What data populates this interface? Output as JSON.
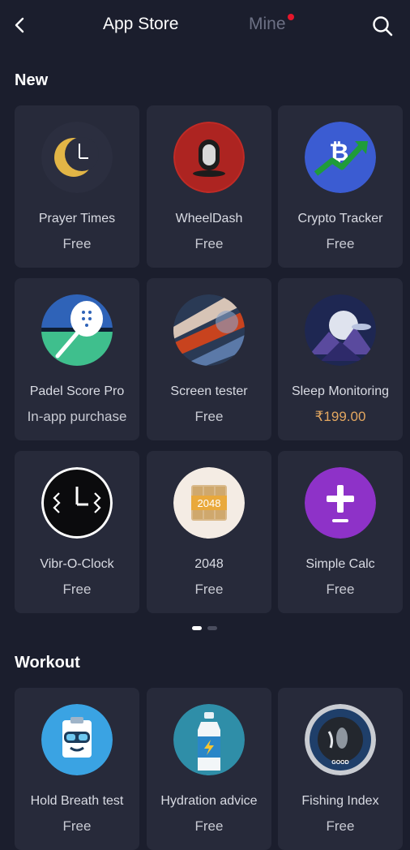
{
  "header": {
    "tab_app_store": "App Store",
    "tab_mine": "Mine",
    "mine_badge_color": "#e5162b"
  },
  "sections": {
    "new": {
      "title": "New",
      "apps": [
        {
          "name": "Prayer Times",
          "price": "Free",
          "icon": "crescent-clock-icon"
        },
        {
          "name": "WheelDash",
          "price": "Free",
          "icon": "unicycle-icon"
        },
        {
          "name": "Crypto Tracker",
          "price": "Free",
          "icon": "bitcoin-chart-icon"
        },
        {
          "name": "Padel Score Pro",
          "price": "In-app purchase",
          "icon": "padel-racket-icon"
        },
        {
          "name": "Screen tester",
          "price": "Free",
          "icon": "abstract-light-icon"
        },
        {
          "name": "Sleep Monitoring",
          "price": "₹199.00",
          "icon": "moon-mountain-icon"
        },
        {
          "name": "Vibr-O-Clock",
          "price": "Free",
          "icon": "vibrating-clock-icon"
        },
        {
          "name": "2048",
          "price": "Free",
          "icon": "tile-2048-icon"
        },
        {
          "name": "Simple Calc",
          "price": "Free",
          "icon": "plus-minus-icon"
        }
      ],
      "page_indicator": {
        "pages": 2,
        "current": 1
      },
      "tile_text": "2048"
    },
    "workout": {
      "title": "Workout",
      "apps": [
        {
          "name": "Hold Breath test",
          "price": "Free",
          "icon": "diving-mask-icon"
        },
        {
          "name": "Hydration advice",
          "price": "Free",
          "icon": "water-bottle-icon"
        },
        {
          "name": "Fishing Index",
          "price": "Free",
          "icon": "fish-gauge-icon"
        }
      ],
      "gauge_text": "GOOD"
    }
  },
  "colors": {
    "background": "#1b1e2d",
    "card": "#272a3a",
    "paid_price": "#e3a760"
  }
}
